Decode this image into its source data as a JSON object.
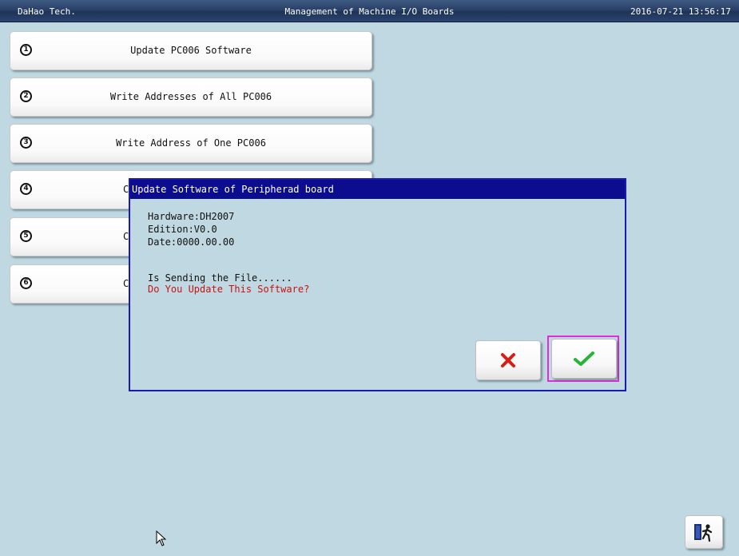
{
  "titlebar": {
    "company": "DaHao Tech.",
    "title": "Management of Machine I/O Boards",
    "datetime": "2016-07-21 13:56:17"
  },
  "menu": [
    {
      "num": "1",
      "label": "Update PC006 Software"
    },
    {
      "num": "2",
      "label": "Write Addresses of All PC006"
    },
    {
      "num": "3",
      "label": "Write Address of One PC006"
    },
    {
      "num": "4",
      "label": "C"
    },
    {
      "num": "5",
      "label": "C"
    },
    {
      "num": "6",
      "label": "C"
    }
  ],
  "dialog": {
    "title": "Update Software of Peripherad board",
    "hardware": "Hardware:DH2007",
    "edition": "Edition:V0.0",
    "date": "Date:0000.00.00",
    "status": "Is Sending the File......",
    "question": "Do You Update This Software?",
    "cancel_icon": "red-x-icon",
    "confirm_icon": "green-check-icon",
    "question_color": "#c81414",
    "selected_outline_color": "#e22bd9"
  },
  "exit_icon": "exit-door-icon"
}
